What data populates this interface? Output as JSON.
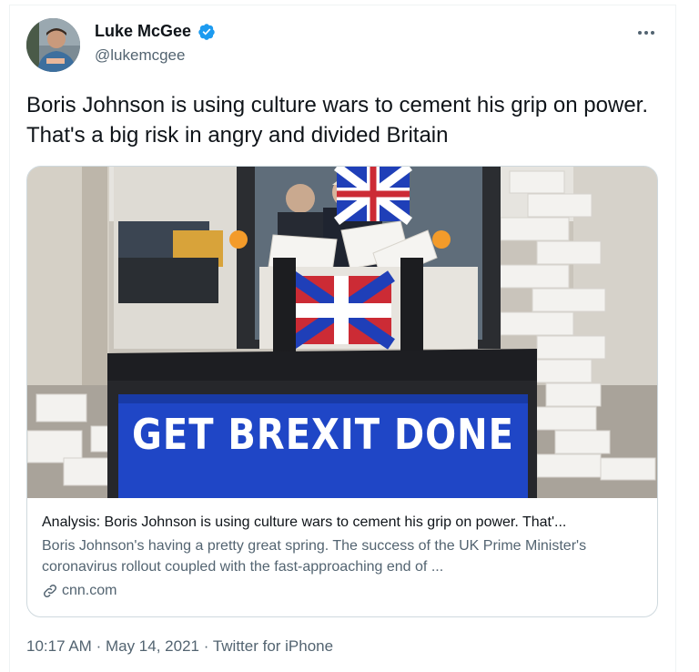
{
  "author": {
    "name": "Luke McGee",
    "handle": "@lukemcgee",
    "verified": true
  },
  "tweet": {
    "text": "Boris Johnson is using culture wars to cement his grip on power. That's a big risk in angry and divided Britain"
  },
  "card": {
    "image_sign_text": "GET BREXIT DONE",
    "title": "Analysis: Boris Johnson is using culture wars to cement his grip on power. That'...",
    "description": "Boris Johnson's having a pretty great spring. The success of the UK Prime Minister's coronavirus rollout coupled with the fast-approaching end of ...",
    "domain": "cnn.com"
  },
  "meta": {
    "time": "10:17 AM",
    "date": "May 14, 2021",
    "source": "Twitter for iPhone",
    "separator": "·"
  },
  "icons": {
    "verified": "verified-badge-icon",
    "more": "more-dots-icon",
    "link": "link-icon"
  },
  "colors": {
    "verified_blue": "#1d9bf0",
    "secondary_text": "#536471",
    "primary_text": "#0f1419",
    "sign_blue": "#1f3fb8"
  }
}
